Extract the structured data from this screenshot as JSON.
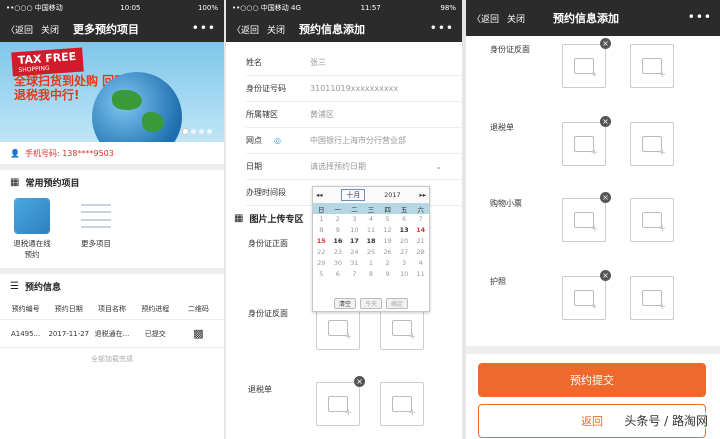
{
  "screen1": {
    "status": {
      "carrier": "••○○○ 中国移动",
      "wifi": "令",
      "time": "10:05",
      "battery": "100%"
    },
    "nav": {
      "back": "返回",
      "close": "关闭",
      "title": "更多预约项目",
      "more": "•••"
    },
    "banner": {
      "badge": "TAX FREE",
      "badge_sub": "SHOPPING",
      "slogan": "全球扫货到处购 回国退税我中行!"
    },
    "phone_label": "手机号码: 138****9503",
    "common": {
      "title": "常用预约项目",
      "items": [
        {
          "label": "退税通在线预约"
        },
        {
          "label": "更多项目"
        }
      ]
    },
    "appointments": {
      "title": "预约信息",
      "headers": [
        "预约编号",
        "预约日期",
        "项目名称",
        "预约进程",
        "二维码"
      ],
      "rows": [
        [
          "A1495...",
          "2017-11-27",
          "退税通在...",
          "已提交",
          ""
        ]
      ],
      "footer": "全部加载完成"
    }
  },
  "screen2": {
    "status": {
      "carrier": "••○○○ 中国移动 4G",
      "time": "11:57",
      "battery": "98%"
    },
    "nav": {
      "back": "返回",
      "close": "关闭",
      "title": "预约信息添加",
      "more": "•••"
    },
    "fields": [
      {
        "label": "姓名",
        "value": "张三"
      },
      {
        "label": "身份证号码",
        "value": "31011019xxxxxxxxxx"
      },
      {
        "label": "所属辖区",
        "value": "黄浦区"
      },
      {
        "label": "网点",
        "value": "中国银行上海市分行营业部"
      },
      {
        "label": "日期",
        "value": "请选择预约日期"
      },
      {
        "label": "办理时间段",
        "value": ""
      }
    ],
    "upload_title": "图片上传专区",
    "uploads": [
      "身份证正面",
      "身份证反面",
      "退税单"
    ],
    "calendar": {
      "month": "十月",
      "year": "2017",
      "weekdays": [
        "日",
        "一",
        "二",
        "三",
        "四",
        "五",
        "六"
      ],
      "days": [
        "1",
        "2",
        "3",
        "4",
        "5",
        "6",
        "7",
        "8",
        "9",
        "10",
        "11",
        "12",
        "13",
        "14",
        "15",
        "16",
        "17",
        "18",
        "19",
        "20",
        "21",
        "22",
        "23",
        "24",
        "25",
        "26",
        "27",
        "28",
        "29",
        "30",
        "31",
        "1",
        "2",
        "3",
        "4",
        "5",
        "6",
        "7",
        "8",
        "9",
        "10",
        "11"
      ],
      "clear": "清空",
      "today": "今天",
      "ok": "确定"
    }
  },
  "screen3": {
    "nav": {
      "back": "返回",
      "close": "关闭",
      "title": "预约信息添加",
      "more": "•••"
    },
    "uploads": [
      "身份证反面",
      "退税单",
      "购物小票",
      "护照"
    ],
    "submit": "预约提交",
    "back_btn": "返回",
    "watermark": "头条号 / 路淘网"
  },
  "colors": {
    "nav": "#2b2b2b",
    "accent": "#f0692c",
    "red": "#d9322c"
  }
}
